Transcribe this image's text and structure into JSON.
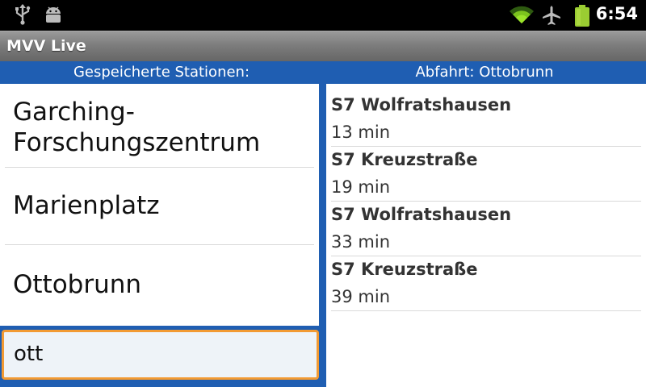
{
  "status_bar": {
    "time": "6:54",
    "icons": [
      "usb-icon",
      "android-debug-icon",
      "wifi-icon",
      "airplane-icon",
      "battery-icon"
    ],
    "icon_color": "#9acd32"
  },
  "app_bar": {
    "title": "MVV Live"
  },
  "stations_panel": {
    "header": "Gespeicherte Stationen:",
    "items": [
      {
        "line1": "Garching-",
        "line2": "Forschungszentrum"
      },
      {
        "label": "Marienplatz"
      },
      {
        "label": "Ottobrunn"
      }
    ],
    "search": {
      "value": "ott"
    }
  },
  "departures_panel": {
    "header": "Abfahrt: Ottobrunn",
    "items": [
      {
        "line": "S7 Wolfratshausen",
        "minutes": "13 min"
      },
      {
        "line": "S7 Kreuzstraße",
        "minutes": "19 min"
      },
      {
        "line": "S7 Wolfratshausen",
        "minutes": "33 min"
      },
      {
        "line": "S7 Kreuzstraße",
        "minutes": "39 min"
      }
    ]
  },
  "colors": {
    "accent": "#1f5eb2",
    "focus": "#f29a33",
    "battery": "#9acd32"
  }
}
